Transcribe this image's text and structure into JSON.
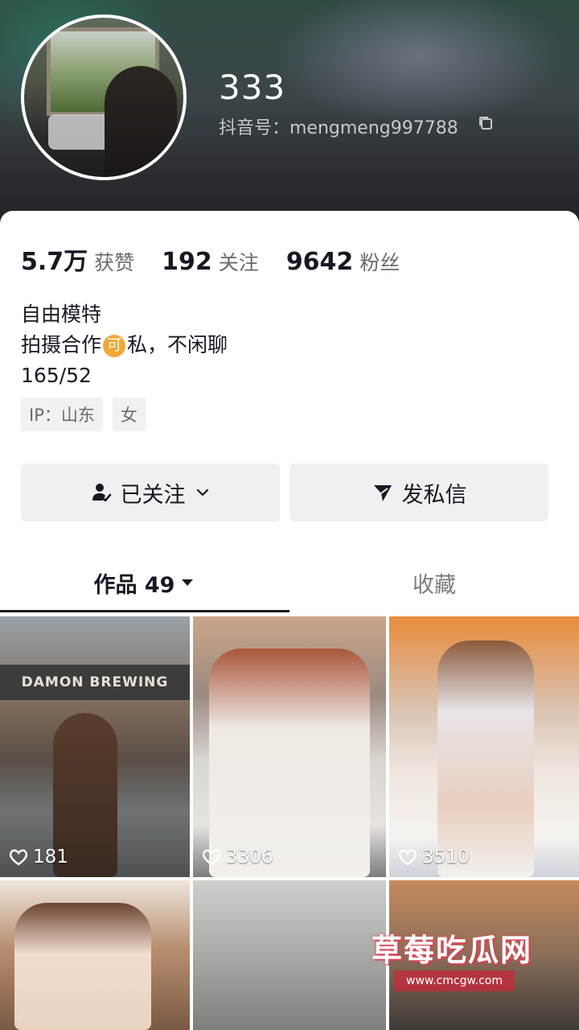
{
  "profile": {
    "name": "333",
    "douyin_id": "抖音号：mengmeng997788",
    "avatar_icon": "avatar-photo"
  },
  "stats": [
    {
      "value": "5.7万",
      "label": "获赞"
    },
    {
      "value": "192",
      "label": "关注"
    },
    {
      "value": "9642",
      "label": "粉丝"
    }
  ],
  "bio": {
    "line1": "自由模特",
    "line2_pre": "拍摄合作",
    "line2_badge": "可",
    "line2_post": "私，不闲聊",
    "line3": "165/52"
  },
  "tags": [
    "IP：山东",
    "女"
  ],
  "buttons": {
    "follow": "已关注",
    "message": "发私信"
  },
  "tabs": {
    "works": "作品 49",
    "favorites": "收藏"
  },
  "posts": [
    {
      "likes": "181"
    },
    {
      "likes": "3306"
    },
    {
      "likes": "3510"
    }
  ],
  "scene": {
    "sign_text": "DAMON BREWING"
  },
  "watermark": {
    "title": "草莓吃瓜网",
    "url": "www.cmcgw.com"
  },
  "colors": {
    "text": "#161823",
    "secondary": "#6a6b70",
    "button_bg": "#f0f0f1",
    "badge": "#f2a637"
  }
}
